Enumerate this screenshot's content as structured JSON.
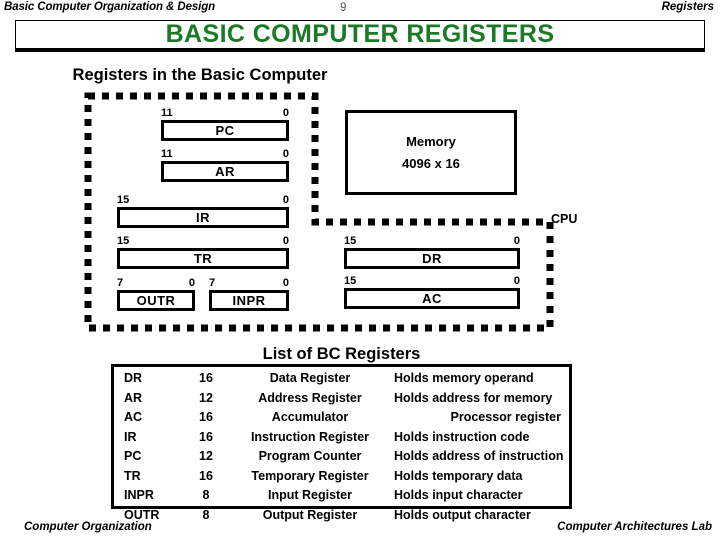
{
  "slide": {
    "header_left": "Basic Computer Organization & Design",
    "page_number": "9",
    "header_right": "Registers",
    "title": "BASIC COMPUTER  REGISTERS",
    "title_color": "#1b7a26",
    "footer_left": "Computer Organization",
    "footer_right": "Computer Architectures Lab"
  },
  "diagram": {
    "heading": "Registers in the Basic Computer",
    "cpu_label": "CPU",
    "memory": {
      "line1": "Memory",
      "line2": "4096 x 16"
    },
    "registers": [
      {
        "name": "PC",
        "msb": "11",
        "lsb": "0"
      },
      {
        "name": "AR",
        "msb": "11",
        "lsb": "0"
      },
      {
        "name": "IR",
        "msb": "15",
        "lsb": "0"
      },
      {
        "name": "TR",
        "msb": "15",
        "lsb": "0"
      },
      {
        "name": "OUTR",
        "msb": "7",
        "lsb": "0"
      },
      {
        "name": "INPR",
        "msb": "7",
        "lsb": "0"
      },
      {
        "name": "DR",
        "msb": "15",
        "lsb": "0"
      },
      {
        "name": "AC",
        "msb": "15",
        "lsb": "0"
      }
    ]
  },
  "table": {
    "heading": "List of BC Registers",
    "rows": [
      {
        "symbol": "DR",
        "bits": "16",
        "name": "Data Register",
        "description": "Holds memory operand",
        "desc_align": "left"
      },
      {
        "symbol": "AR",
        "bits": "12",
        "name": "Address Register",
        "description": "Holds address for memory",
        "desc_align": "left"
      },
      {
        "symbol": "AC",
        "bits": "16",
        "name": "Accumulator",
        "description": "Processor register",
        "desc_align": "right"
      },
      {
        "symbol": "IR",
        "bits": "16",
        "name": "Instruction Register",
        "description": "Holds instruction code",
        "desc_align": "left"
      },
      {
        "symbol": "PC",
        "bits": "12",
        "name": "Program Counter",
        "description": "Holds address of instruction",
        "desc_align": "left"
      },
      {
        "symbol": "TR",
        "bits": "16",
        "name": "Temporary Register",
        "description": "Holds temporary data",
        "desc_align": "left"
      },
      {
        "symbol": "INPR",
        "bits": "8",
        "name": "Input Register",
        "description": "Holds input character",
        "desc_align": "left"
      },
      {
        "symbol": "OUTR",
        "bits": "8",
        "name": "Output Register",
        "description": "Holds output character",
        "desc_align": "left"
      }
    ]
  }
}
